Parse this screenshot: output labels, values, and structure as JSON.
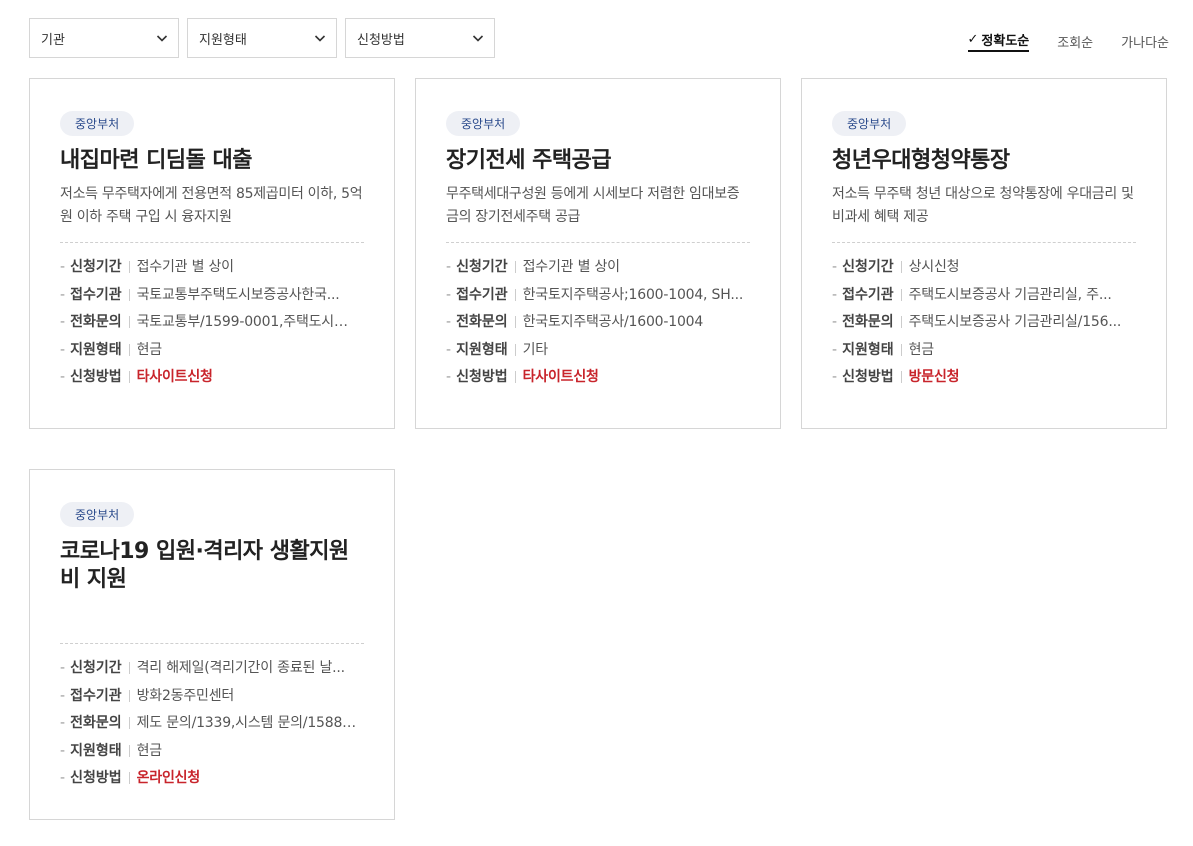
{
  "filters": [
    {
      "label": "기관"
    },
    {
      "label": "지원형태"
    },
    {
      "label": "신청방법"
    }
  ],
  "sort": {
    "items": [
      {
        "label": "정확도순",
        "active": true
      },
      {
        "label": "조회순",
        "active": false
      },
      {
        "label": "가나다순",
        "active": false
      }
    ],
    "check_icon": "✓"
  },
  "info_labels": {
    "period": "신청기간",
    "agency": "접수기관",
    "phone": "전화문의",
    "support": "지원형태",
    "method": "신청방법"
  },
  "accent_color": "#c8242b",
  "cards": [
    {
      "badge": "중앙부처",
      "title": "내집마련 디딤돌 대출",
      "desc": "저소득 무주택자에게 전용면적 85제곱미터 이하, 5억원 이하 주택 구입 시 융자지원",
      "period": "접수기관 별 상이",
      "agency": "국토교통부주택도시보증공사한국...",
      "phone": "국토교통부/1599-0001,주택도시보...",
      "support": "현금",
      "method": "타사이트신청"
    },
    {
      "badge": "중앙부처",
      "title": "장기전세 주택공급",
      "desc": "무주택세대구성원 등에게 시세보다 저렴한 임대보증금의 장기전세주택 공급",
      "period": "접수기관 별 상이",
      "agency": "한국토지주택공사;1600-1004, SH...",
      "phone": "한국토지주택공사/1600-1004",
      "support": "기타",
      "method": "타사이트신청"
    },
    {
      "badge": "중앙부처",
      "title": "청년우대형청약통장",
      "desc": "저소득 무주택 청년 대상으로 청약통장에 우대금리 및 비과세 혜택 제공",
      "period": "상시신청",
      "agency": "주택도시보증공사 기금관리실, 주...",
      "phone": "주택도시보증공사 기금관리실/156...",
      "support": "현금",
      "method": "방문신청"
    },
    {
      "badge": "중앙부처",
      "title": "코로나19 입원·격리자 생활지원비 지원",
      "desc": "",
      "period": "격리 해제일(격리기간이 종료된 날...",
      "agency": "방화2동주민센터",
      "phone": "제도 문의/1339,시스템 문의/1588-...",
      "support": "현금",
      "method": "온라인신청"
    }
  ]
}
